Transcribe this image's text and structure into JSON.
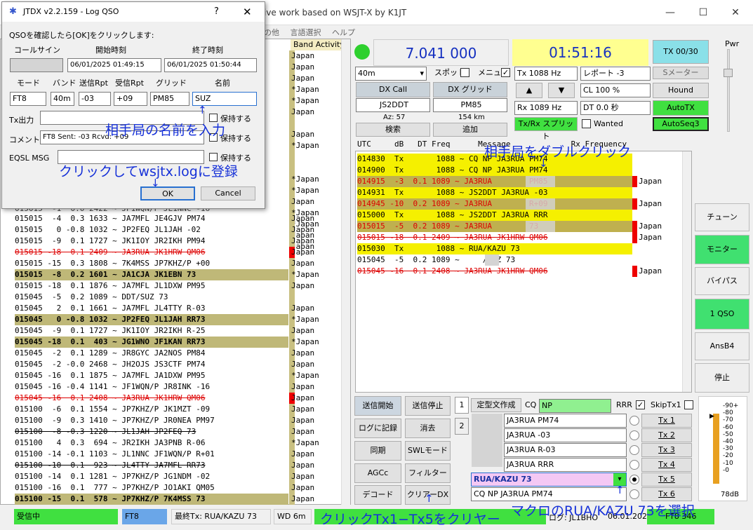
{
  "main_title": "ive work based on WSJT-X by K1JT",
  "menu": [
    "の他",
    "言語選択",
    "ヘルプ"
  ],
  "band": {
    "header": "Band Activity",
    "rows": [
      {
        "t": "015015  -4  0.3 1633 ~ JA7MFL JE4GJV PM74",
        "c": "Japan",
        "s": ""
      },
      {
        "t": "015015   0 -0.8 1032 ~ JP2FEQ JL1JAH -02",
        "c": "Japan",
        "s": ""
      },
      {
        "t": "015015  -9  0.1 1727 ~ JK1IOY JR2IKH PM94",
        "c": "Japan",
        "s": ""
      },
      {
        "t": "015015 -18  0.1 2409 ~ JA3RUA JK1HRW QM06",
        "c": "Japan",
        "s": "red"
      },
      {
        "t": "015015 -15  0.3 1808 ~ 7K4MSS JP7KHZ/P +00",
        "c": "Japan",
        "s": ""
      },
      {
        "t": "015015  -8  0.2 1601 ~ JA1CJA JK1EBN 73",
        "c": "*Japan",
        "s": "hl"
      },
      {
        "t": "015015 -18  0.1 1876 ~ JA7MFL JL1DXW PM95",
        "c": "Japan",
        "s": ""
      },
      {
        "t": "015045  -5  0.2 1089 ~ DDT/SUZ 73",
        "c": "",
        "s": ""
      },
      {
        "t": "015045   2  0.1 1661 ~ JA7MFL JL4TTY R-03",
        "c": "Japan",
        "s": ""
      },
      {
        "t": "015045   0 -0.8 1032 ~ JP2FEQ JL1JAH RR73",
        "c": "*Japan",
        "s": "hl"
      },
      {
        "t": "015045  -9  0.1 1727 ~ JK1IOY JR2IKH R-25",
        "c": "Japan",
        "s": ""
      },
      {
        "t": "015045 -18  0.1  403 ~ JG1WNO JF1KAN RR73",
        "c": "*Japan",
        "s": "hl"
      },
      {
        "t": "015045  -2  0.1 1289 ~ JR8GYC JA2NOS PM84",
        "c": "Japan",
        "s": ""
      },
      {
        "t": "015045  -2 -0.0 2468 ~ JH2OJS JS3CTF PM74",
        "c": "Japan",
        "s": ""
      },
      {
        "t": "015045 -16  0.1 1875 ~ JA7MFL JA1DXW PM95",
        "c": "*Japan",
        "s": ""
      },
      {
        "t": "015045 -16 -0.4 1141 ~ JF1WQN/P JR8INK -16",
        "c": "Japan",
        "s": ""
      },
      {
        "t": "015045 -16  0.1 2408 ~ JA3RUA JK1HRW QM06",
        "c": "Japan",
        "s": "red"
      },
      {
        "t": "015100  -6  0.1 1554 ~ JP7KHZ/P JK1MZT -09",
        "c": "Japan",
        "s": ""
      },
      {
        "t": "015100  -9  0.3 1410 ~ JP7KHZ/P JR0NEA PM97",
        "c": "Japan",
        "s": ""
      },
      {
        "t": "015100  -8 -0.3 1220 ~ JL1JAH JP2FEQ 73",
        "c": "Japan",
        "s": "strike"
      },
      {
        "t": "015100   4  0.3  694 ~ JR2IKH JA3PNB R-06",
        "c": "*Japan",
        "s": ""
      },
      {
        "t": "015100 -14 -0.1 1103 ~ JL1NNC JF1WQN/P R+01",
        "c": "Japan",
        "s": ""
      },
      {
        "t": "015100 -10  0.1  923 ~ JL4TTY JA7MFL RR73",
        "c": "Japan",
        "s": "strike"
      },
      {
        "t": "015100 -14  0.1 1281 ~ JP7KHZ/P JG1NDM -02",
        "c": "Japan",
        "s": ""
      },
      {
        "t": "015100 -16  0.1  777 ~ JP7KHZ/P JO1AKI QM05",
        "c": "Japan",
        "s": ""
      },
      {
        "t": "015100 -15  0.1  578 ~ JP7KHZ/P 7K4MSS 73",
        "c": "Japan",
        "s": "hl"
      }
    ],
    "upper_ctys": [
      "Japan",
      "Japan",
      "Japan",
      "*Japan",
      "*Japan",
      "Japan",
      "",
      "Japan",
      "*Japan",
      "",
      "",
      "*Japan",
      "*Japan",
      "Japan",
      "*Japan",
      "*Japan",
      "Japan",
      "Japan"
    ],
    "partial_row": "015015  -1  0.0 2422 ~ JP1WQN/P JL1NNC -16"
  },
  "freq": "7.041 000",
  "time": "01:51:16",
  "tx_counter": "TX 00/30",
  "pwr": "Pwr",
  "band_sel": "40m",
  "split_lbl": "スポット",
  "menu_lbl": "メニュー",
  "tx_hz": "Tx  1088  Hz",
  "rx_hz": "Rx  1089  Hz",
  "report": "レポート -3",
  "smeter": "Sメーター",
  "cl": "CL  100 %",
  "dt": "DT 0.0 秒",
  "hound": "Hound",
  "autotx": "AutoTX",
  "autoseq": "AutoSeq3",
  "wanted": "Wanted",
  "txrx_split": "Tx/Rx スプリット",
  "dxcall_btn": "DX Call",
  "dxgrid_btn": "DX グリッド",
  "dxcall": "JS2DDT",
  "dxgrid": "PM85",
  "az": "Az: 57",
  "dist": "154 km",
  "search": "検索",
  "add": "追加",
  "rx_header": "UTC     dB   DT Freq      Message             Rx Frequency",
  "rx_rows": [
    {
      "t": "014830  Tx       1088 ~ CQ NP JA3RUA PM74",
      "s": "y",
      "c": ""
    },
    {
      "t": "014900  Tx       1088 ~ CQ NP JA3RUA PM74",
      "s": "y",
      "c": ""
    },
    {
      "t": "014915  -3  0.1 1089 ~ JA3RUA        PM85",
      "s": "o red",
      "c": "Japan"
    },
    {
      "t": "014931  Tx       1088 ~ JS2DDT JA3RUA -03",
      "s": "y",
      "c": ""
    },
    {
      "t": "014945 -10  0.2 1089 ~ JA3RUA        R+09",
      "s": "o red",
      "c": "Japan"
    },
    {
      "t": "015000  Tx       1088 ~ JS2DDT JA3RUA RRR",
      "s": "y",
      "c": ""
    },
    {
      "t": "015015  -5  0.2 1089 ~ JA3RUA        73",
      "s": "o red",
      "c": "Japan"
    },
    {
      "t": "015015 -18  0.1 2409 ~ JA3RUA JK1HRW QM06",
      "s": "red",
      "c": "Japan"
    },
    {
      "t": "015030  Tx       1088 ~ RUA/KAZU 73",
      "s": "y",
      "c": ""
    },
    {
      "t": "015045  -5  0.2 1089 ~     /SUZ 73",
      "s": "",
      "c": ""
    },
    {
      "t": "015045 -16  0.1 2408 ~ JA3RUA JK1HRW QM06",
      "s": "red",
      "c": "Japan"
    }
  ],
  "right_btns": [
    "チューン",
    "モニター",
    "バイパス",
    "1 QSO",
    "AnsB4",
    "停止"
  ],
  "bottom_btns": [
    "送信開始",
    "送信停止",
    "ログに記録",
    "消去",
    "同期",
    "SWLモード",
    "AGCc",
    "フィルター",
    "デコード",
    "クリアーDX"
  ],
  "tab1": "1",
  "tab2": "2",
  "teikei": "定型文作成",
  "cq_lbl": "CQ",
  "cq_val": "NP",
  "rrr": "RRR",
  "skiptx1": "SkipTx1",
  "tx_msgs": [
    "JA3RUA PM74",
    "JA3RUA -03",
    "JA3RUA R-03",
    "JA3RUA RRR",
    "RUA/KAZU 73",
    "CQ NP JA3RUA PM74"
  ],
  "tx_btns": [
    "Tx 1",
    "Tx 2",
    "Tx 3",
    "Tx 4",
    "Tx 5",
    "Tx 6"
  ],
  "meter_ticks": [
    "90+",
    "80",
    "70",
    "60",
    "50",
    "40",
    "30",
    "20",
    "10",
    "0"
  ],
  "meter_db": "78dB",
  "status": {
    "rx": "受信中",
    "mode": "FT8",
    "last_tx": "最終Tx: RUA/KAZU 73",
    "wd": "WD 6m",
    "log": "ログ: JL1BHO",
    "date": "06.01.2025",
    "ft8": "FT8 346"
  },
  "dialog": {
    "title": "JTDX v2.2.159 - Log QSO",
    "help": "?",
    "close": "✕",
    "instruction": "QSOを確認したら[OK]をクリックします:",
    "callsign_lbl": "コールサイン",
    "start_lbl": "開始時刻",
    "end_lbl": "終了時刻",
    "start_val": "06/01/2025 01:49:15",
    "end_val": "06/01/2025 01:50:44",
    "mode_lbl": "モード",
    "band_lbl": "バンド",
    "sent_lbl": "送信Rpt",
    "rcvd_lbl": "受信Rpt",
    "grid_lbl": "グリッド",
    "name_lbl": "名前",
    "mode_val": "FT8",
    "band_val": "40m",
    "sent_val": "-03",
    "rcvd_val": "+09",
    "grid_val": "PM85",
    "name_val": "SUZ",
    "txpwr_lbl": "Tx出力",
    "comment_lbl": "コメント",
    "comment_val": "FT8  Sent: -03  Rcvd: +09",
    "eqsl_lbl": "EQSL MSG",
    "keep": "保持する",
    "ok": "OK",
    "cancel": "Cancel"
  },
  "annotations": {
    "a1": "相手局の名前を入力",
    "a2": "クリックしてwsjtx.logに登録",
    "a3": "相手局をダブルクリック",
    "a4": "クリックTx1−Tx5をクリヤー",
    "a5": "マクロのRUA/KAZU 73を選択"
  }
}
